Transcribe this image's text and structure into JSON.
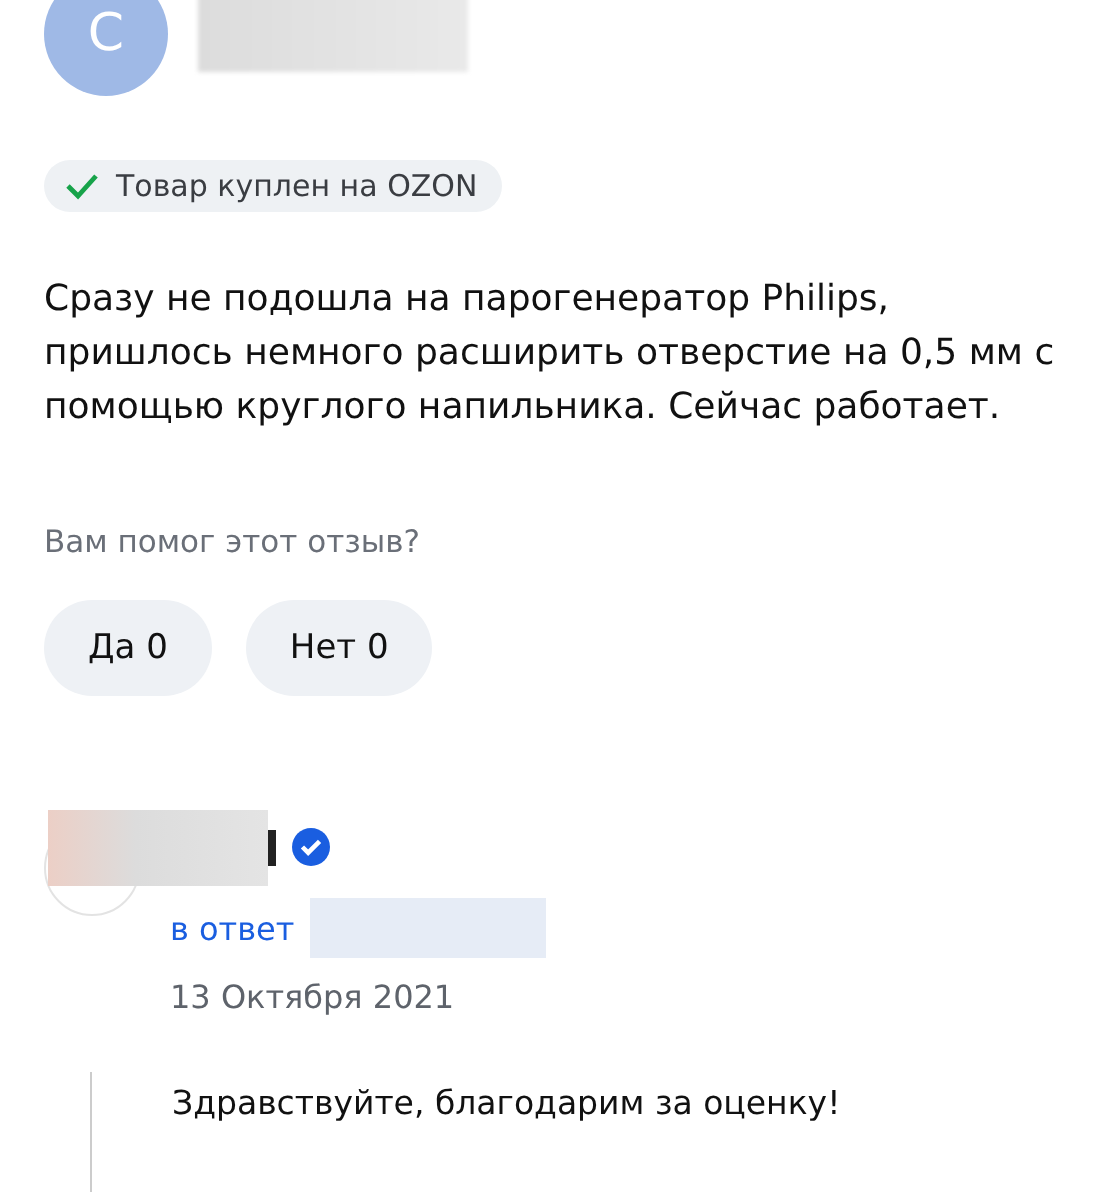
{
  "review": {
    "avatar_letter": "С",
    "badge": "Товар куплен на OZON",
    "text": "Сразу не подошла на парогенератор Philips, пришлось немного расширить отверстие на 0,5 мм с помощью круглого напильника. Сейчас работает.",
    "helpful_question": "Вам помог этот отзыв?",
    "votes": [
      {
        "label": "Да 0"
      },
      {
        "label": "Нет 0"
      }
    ]
  },
  "reply": {
    "verified": true,
    "in_reply_label": "в ответ",
    "date": "13 Октября 2021",
    "text": "Здравствуйте, благодарим за оценку!"
  }
}
